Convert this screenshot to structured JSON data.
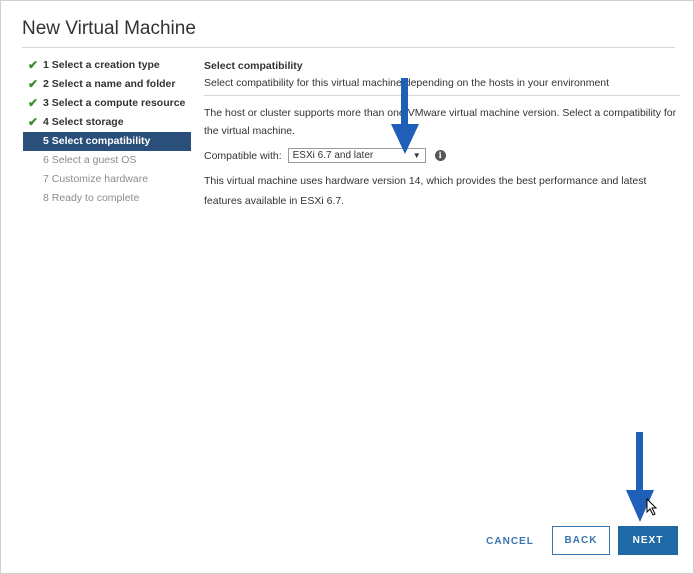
{
  "dialog": {
    "title": "New Virtual Machine"
  },
  "steps": [
    {
      "label": "1 Select a creation type",
      "state": "done"
    },
    {
      "label": "2 Select a name and folder",
      "state": "done"
    },
    {
      "label": "3 Select a compute resource",
      "state": "done"
    },
    {
      "label": "4 Select storage",
      "state": "done"
    },
    {
      "label": "5 Select compatibility",
      "state": "active"
    },
    {
      "label": "6 Select a guest OS",
      "state": "pending"
    },
    {
      "label": "7 Customize hardware",
      "state": "pending"
    },
    {
      "label": "8 Ready to complete",
      "state": "pending"
    }
  ],
  "content": {
    "heading": "Select compatibility",
    "subheading": "Select compatibility for this virtual machine depending on the hosts in your environment",
    "paragraph1": "The host or cluster supports more than one VMware virtual machine version. Select a compatibility for the virtual machine.",
    "compat_label": "Compatible with:",
    "compat_value": "ESXi 6.7 and later",
    "paragraph2": "This virtual machine uses hardware version 14, which provides the best performance and latest features available in ESXi 6.7."
  },
  "footer": {
    "cancel": "CANCEL",
    "back": "BACK",
    "next": "NEXT"
  },
  "icons": {
    "check": "checkmark-icon",
    "info": "info-icon",
    "dropdown": "dropdown-arrow-icon"
  },
  "colors": {
    "active_step_bg": "#2a4f7a",
    "check_green": "#3c8d2f",
    "primary_button": "#1f6aa6",
    "annotation_arrow": "#1f5fb8"
  }
}
